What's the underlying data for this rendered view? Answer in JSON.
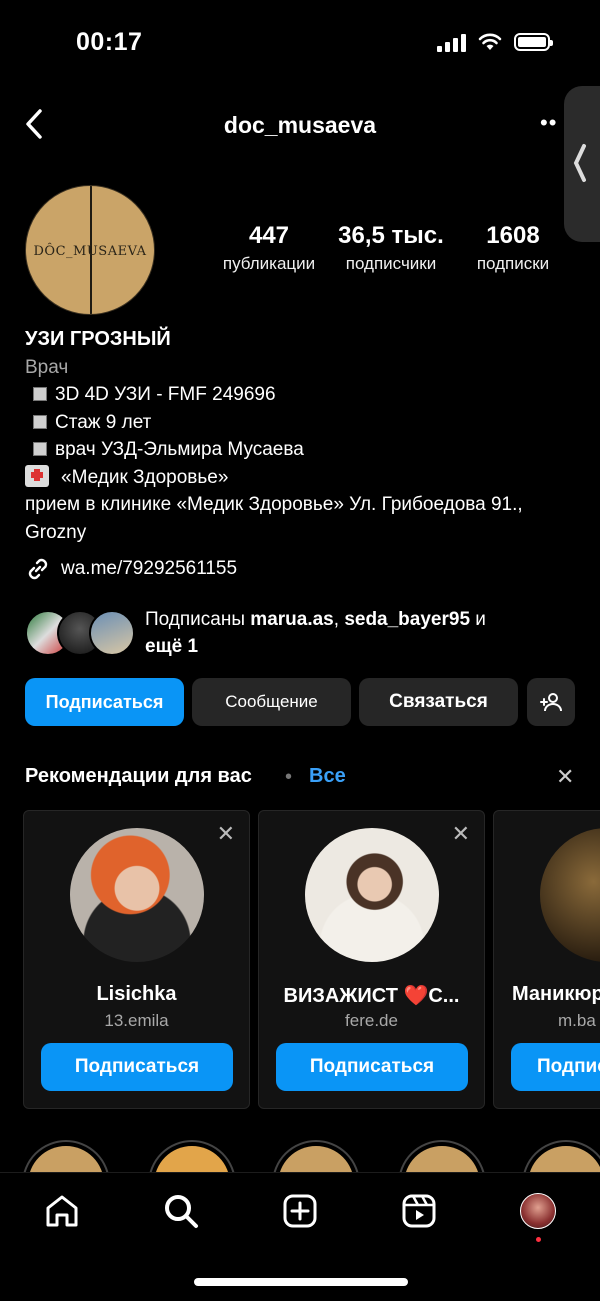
{
  "status": {
    "time": "00:17"
  },
  "header": {
    "username": "doc_musaeva"
  },
  "avatar": {
    "logo_text": "DÔC_MUSAEVA"
  },
  "stats": [
    {
      "value": "447",
      "label": "публикации"
    },
    {
      "value": "36,5 тыс.",
      "label": "подписчики"
    },
    {
      "value": "1608",
      "label": "подписки"
    }
  ],
  "bio": {
    "name": "УЗИ ГРОЗНЫЙ",
    "category": "Врач",
    "line1": "3D 4D УЗИ - FMF 249696",
    "line2": "Стаж 9 лет",
    "line3": "врач УЗД-Эльмира Мусаева",
    "line4": "«Медик Здоровье»",
    "line5": "прием в клинике  «Медик Здоровье» Ул. Грибоедова 91., Grozny",
    "link": "wa.me/79292561155"
  },
  "followed_by": {
    "prefix": "Подписаны ",
    "user1": "marua.as",
    "sep": ", ",
    "user2": "seda_bayer95",
    "and": " и",
    "more": "ещё 1"
  },
  "actions": {
    "follow": "Подписаться",
    "message": "Сообщение",
    "contact": "Связаться"
  },
  "recommendations": {
    "title": "Рекомендации для вас",
    "dot": "•",
    "see_all": "Все",
    "close": "✕",
    "cards": [
      {
        "name": "Lisichka",
        "handle": "13.emila",
        "button": "Подписаться"
      },
      {
        "name": "ВИЗАЖИСТ ❤️С...",
        "handle": "fere.de",
        "button": "Подписаться"
      },
      {
        "name": "Маникюр",
        "handle": "m.ba",
        "button": "Подписаться"
      }
    ]
  }
}
